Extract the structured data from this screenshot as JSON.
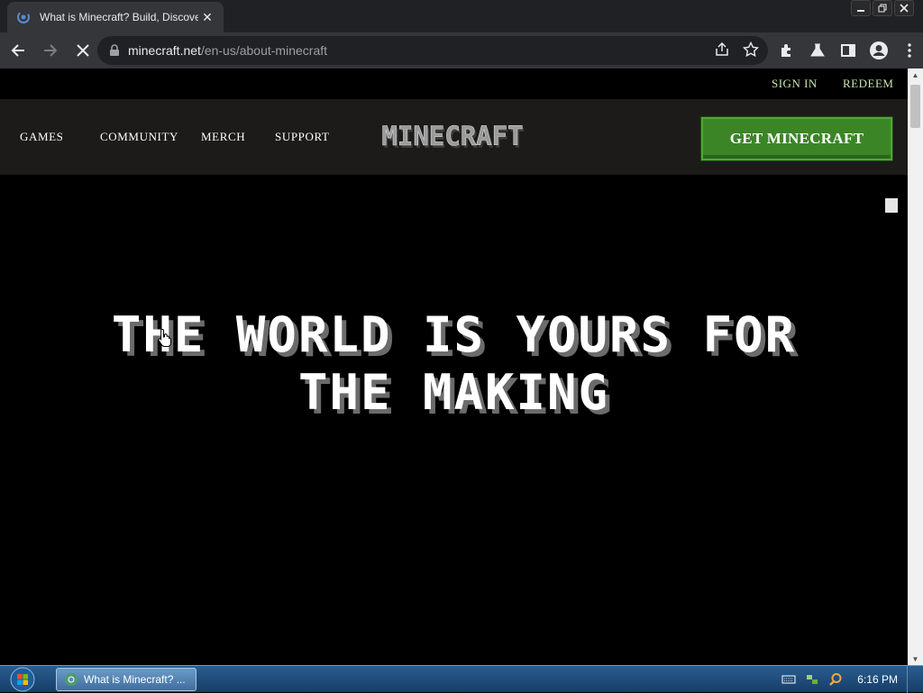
{
  "browser": {
    "tab_title": "What is Minecraft? Build, Discove",
    "tab_close": "✕",
    "url_host": "minecraft.net",
    "url_path": "/en-us/about-minecraft"
  },
  "site": {
    "utility": {
      "sign_in": "SIGN IN",
      "redeem": "REDEEM"
    },
    "nav": {
      "games": "GAMES",
      "community": "COMMUNITY",
      "merch": "MERCH",
      "support": "SUPPORT"
    },
    "logo_text": "MINECRAFT",
    "cta": "GET MINECRAFT",
    "hero": {
      "line1": "THE WORLD IS YOURS FOR",
      "line2": "THE MAKING"
    }
  },
  "taskbar": {
    "task_label": "What is Minecraft? ...",
    "clock": "6:16 PM"
  },
  "colors": {
    "cta_green": "#3c8527",
    "nav_bg": "#1c1b19",
    "util_link": "#c8e6b0"
  }
}
